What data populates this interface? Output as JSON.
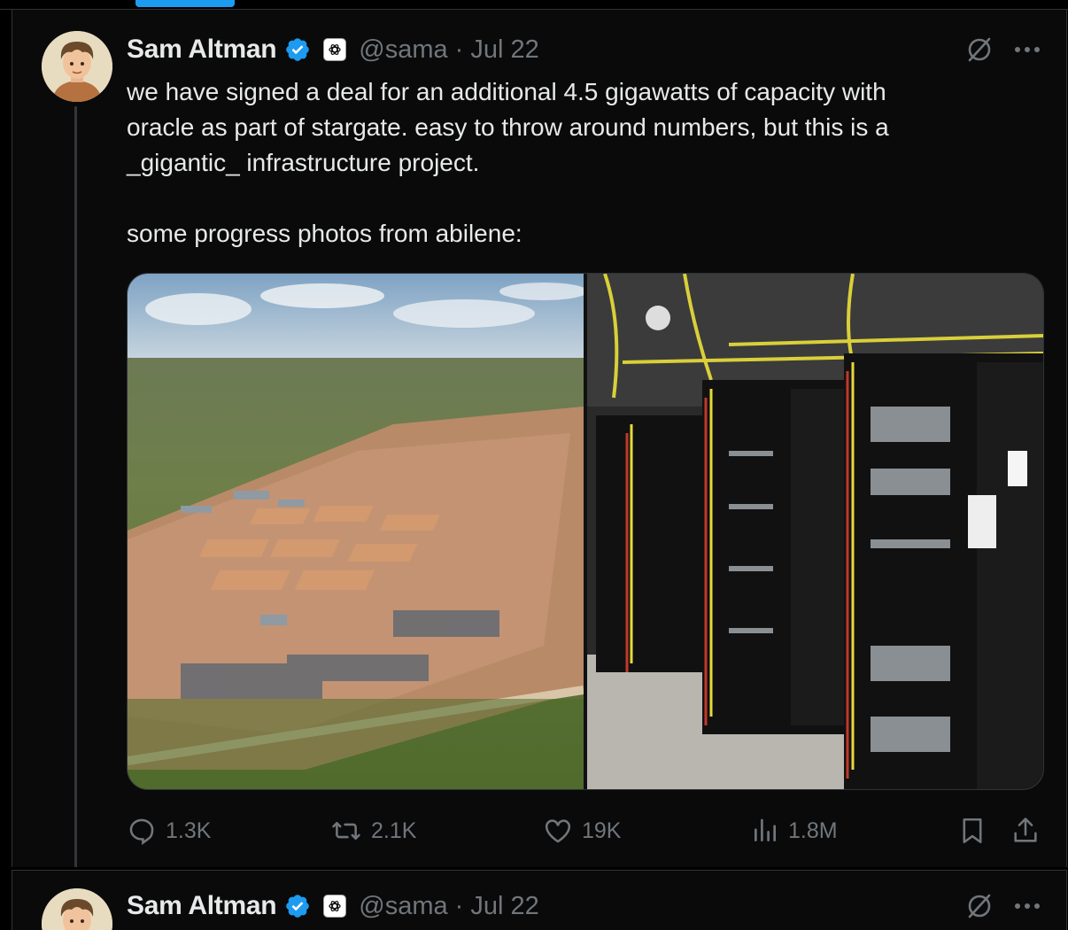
{
  "tweets": [
    {
      "author": {
        "name": "Sam Altman",
        "handle": "@sama",
        "date": "Jul 22",
        "separator": "·"
      },
      "text": "we have signed a deal for an additional 4.5 gigawatts of capacity with\noracle as part of stargate. easy to throw around numbers, but this is a\n_gigantic_ infrastructure project.\n\nsome progress photos from abilene:",
      "stats": {
        "replies": "1.3K",
        "reposts": "2.1K",
        "likes": "19K",
        "views": "1.8M"
      }
    },
    {
      "author": {
        "name": "Sam Altman",
        "handle": "@sama",
        "date": "Jul 22",
        "separator": "·"
      }
    }
  ],
  "icons": {
    "verified": "verified-badge-icon",
    "affiliation": "openai-logo-icon",
    "grok": "grok-icon",
    "more": "more-icon",
    "reply": "reply-icon",
    "repost": "repost-icon",
    "like": "like-icon",
    "views": "views-icon",
    "bookmark": "bookmark-icon",
    "share": "share-icon"
  },
  "colors": {
    "accent": "#1d9bf0",
    "text": "#e7e9ea",
    "muted": "#71767b",
    "border": "#2f3336"
  }
}
